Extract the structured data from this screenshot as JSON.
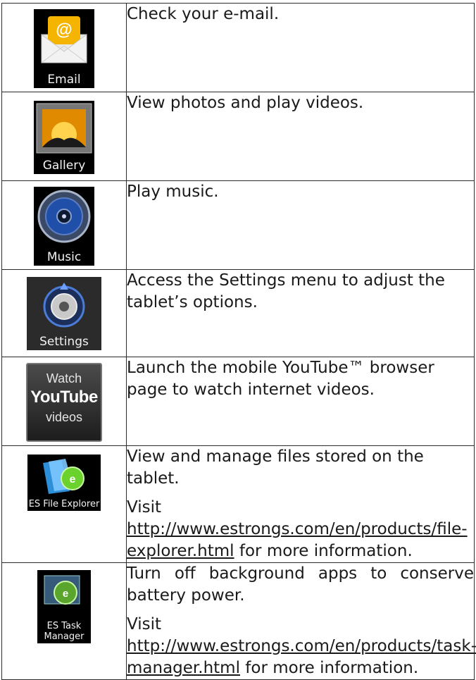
{
  "rows": [
    {
      "icon_name": "email-icon",
      "icon_label": "Email",
      "paragraphs": [
        {
          "text": "Check your e-mail."
        }
      ]
    },
    {
      "icon_name": "gallery-icon",
      "icon_label": "Gallery",
      "paragraphs": [
        {
          "text": "View photos and play videos."
        }
      ]
    },
    {
      "icon_name": "music-icon",
      "icon_label": "Music",
      "paragraphs": [
        {
          "text": "Play music."
        }
      ]
    },
    {
      "icon_name": "settings-icon",
      "icon_label": "Settings",
      "paragraphs": [
        {
          "text": "Access the Settings menu to adjust the tablet’s options."
        }
      ]
    },
    {
      "icon_name": "youtube-icon",
      "icon_label_top": "Watch",
      "icon_label_logo": "YouTube",
      "icon_label_bottom": "videos",
      "paragraphs": [
        {
          "text": "Launch the mobile YouTube™ browser page to watch internet videos."
        }
      ]
    },
    {
      "icon_name": "es-file-explorer-icon",
      "icon_label": "ES File Explorer",
      "paragraphs": [
        {
          "text": "View and manage files stored on the tablet."
        },
        {
          "prefix": "Visit",
          "link": "http://www.estrongs.com/en/products/file-explorer.html",
          "suffix": "for more information."
        }
      ]
    },
    {
      "icon_name": "es-task-manager-icon",
      "icon_label_line1": "ES Task",
      "icon_label_line2": "Manager",
      "paragraphs": [
        {
          "text": "Turn off background apps to conserve battery power."
        },
        {
          "prefix": "Visit",
          "link": "http://www.estrongs.com/en/products/task-manager.html",
          "suffix": "for more information."
        }
      ]
    }
  ]
}
